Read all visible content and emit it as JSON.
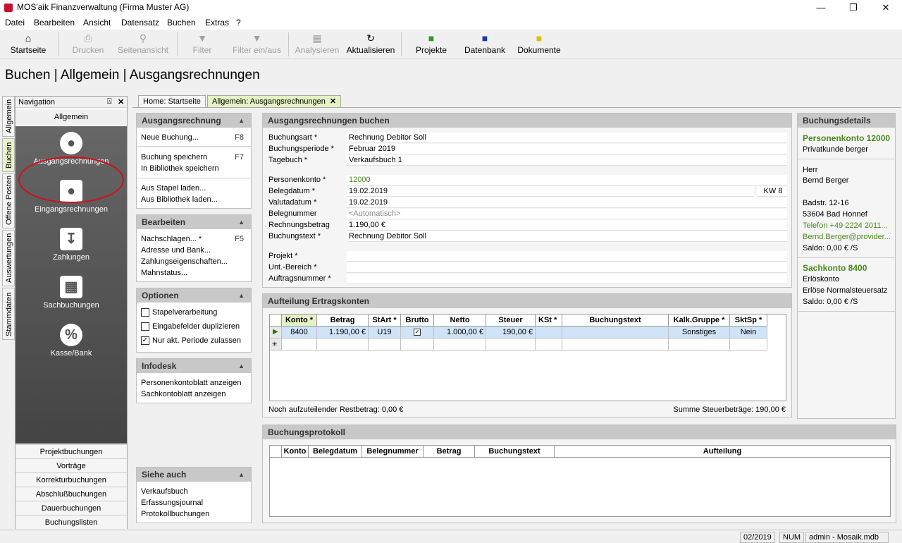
{
  "window": {
    "title": "MOS'aik Finanzverwaltung (Firma Muster AG)",
    "minimize": "—",
    "maximize": "❐",
    "close": "✕"
  },
  "menu": [
    "Datei",
    "Bearbeiten",
    "Ansicht",
    "Datensatz",
    "Buchen",
    "Extras",
    "?"
  ],
  "toolbar": {
    "startseite": "Startseite",
    "drucken": "Drucken",
    "seitenansicht": "Seitenansicht",
    "filter": "Filter",
    "filter_einaus": "Filter ein/aus",
    "analysieren": "Analysieren",
    "aktualisieren": "Aktualisieren",
    "projekte": "Projekte",
    "datenbank": "Datenbank",
    "dokumente": "Dokumente"
  },
  "page_title": "Buchen | Allgemein | Ausgangsrechnungen",
  "side_tabs": [
    "Allgemein",
    "Buchen",
    "Offene Posten",
    "Auswertungen",
    "Stammdaten"
  ],
  "navigation": {
    "title": "Navigation",
    "pin": "⍓",
    "close": "✕",
    "group": "Allgemein",
    "big_items": [
      "Ausgangsrechnungen",
      "Eingangsrechnungen",
      "Zahlungen",
      "Sachbuchungen",
      "Kasse/Bank"
    ],
    "list_items": [
      "Projektbuchungen",
      "Vorträge",
      "Korrekturbuchungen",
      "Abschlußbuchungen",
      "Dauerbuchungen",
      "Buchungslisten"
    ]
  },
  "doc_tabs": {
    "home": "Home: Startseite",
    "current": "Allgemein: Ausgangsrechnungen"
  },
  "tasks": {
    "ausgangsrechnung": {
      "title": "Ausgangsrechnung",
      "neue": "Neue Buchung...",
      "neue_key": "F8",
      "speichern": "Buchung speichern",
      "speichern_key": "F7",
      "bibliothek_speichern": "In Bibliothek speichern",
      "stapel": "Aus Stapel laden...",
      "bibliothek_laden": "Aus Bibliothek laden..."
    },
    "bearbeiten": {
      "title": "Bearbeiten",
      "nachschlagen": "Nachschlagen... *",
      "nachschlagen_key": "F5",
      "adresse": "Adresse und Bank...",
      "zahlung": "Zahlungseigenschaften...",
      "mahn": "Mahnstatus..."
    },
    "optionen": {
      "title": "Optionen",
      "stapel": "Stapelverarbeitung",
      "stapel_checked": false,
      "duplizieren": "Eingabefelder duplizieren",
      "duplizieren_checked": false,
      "periode": "Nur akt. Periode zulassen",
      "periode_checked": true
    },
    "infodesk": {
      "title": "Infodesk",
      "personen": "Personenkontoblatt anzeigen",
      "sach": "Sachkontoblatt anzeigen"
    },
    "siehe": {
      "title": "Siehe auch",
      "verkauf": "Verkaufsbuch",
      "erfassung": "Erfassungsjournal",
      "protokoll": "Protokollbuchungen"
    }
  },
  "form": {
    "title": "Ausgangsrechnungen buchen",
    "fields": {
      "buchungsart": {
        "label": "Buchungsart *",
        "value": "Rechnung Debitor Soll"
      },
      "buchungsperiode": {
        "label": "Buchungsperiode *",
        "value": "Februar 2019"
      },
      "tagebuch": {
        "label": "Tagebuch *",
        "value": "Verkaufsbuch 1"
      },
      "personenkonto": {
        "label": "Personenkonto *",
        "value": "12000"
      },
      "belegdatum": {
        "label": "Belegdatum *",
        "value": "19.02.2019",
        "kw": "KW 8"
      },
      "valutadatum": {
        "label": "Valutadatum *",
        "value": "19.02.2019"
      },
      "belegnummer": {
        "label": "Belegnummer",
        "value": "<Automatisch>"
      },
      "rechnungsbetrag": {
        "label": "Rechnungsbetrag",
        "value": "1.190,00 €"
      },
      "buchungstext": {
        "label": "Buchungstext *",
        "value": "Rechnung Debitor Soll"
      },
      "projekt": {
        "label": "Projekt *",
        "value": ""
      },
      "bereich": {
        "label": "Unt.-Bereich *",
        "value": ""
      },
      "auftrag": {
        "label": "Auftragsnummer *",
        "value": ""
      }
    }
  },
  "aufteilung": {
    "title": "Aufteilung Ertragskonten",
    "columns": [
      "Konto *",
      "Betrag",
      "StArt *",
      "Brutto",
      "Netto",
      "Steuer",
      "KSt *",
      "Buchungstext",
      "Kalk.Gruppe *",
      "SktSp *"
    ],
    "row": {
      "konto": "8400",
      "betrag": "1.190,00 €",
      "start": "U19",
      "brutto": true,
      "netto": "1.000,00 €",
      "steuer": "190,00 €",
      "kst": "",
      "text": "",
      "kalk": "Sonstiges",
      "sktsp": "Nein"
    },
    "new_row_marker": "✳",
    "restbetrag": "Noch aufzuteilender Restbetrag: 0,00 €",
    "steuersumme": "Summe Steuerbeträge: 190,00 €"
  },
  "protokoll": {
    "title": "Buchungsprotokoll",
    "columns": [
      "Konto",
      "Belegdatum",
      "Belegnummer",
      "Betrag",
      "Buchungstext",
      "Aufteilung"
    ]
  },
  "details": {
    "title": "Buchungsdetails",
    "personen_title": "Personenkonto 12000",
    "personen_sub": "Privatkunde berger",
    "anrede": "Herr",
    "name": "Bernd Berger",
    "strasse": "Badstr. 12-16",
    "ort": "53604 Bad Honnef",
    "telefon": "Telefon +49 2224 2011...",
    "email": "Bernd.Berger@provider...",
    "saldo1": "Saldo: 0,00 € /S",
    "sach_title": "Sachkonto 8400",
    "sach_sub": "Erlöskonto",
    "sach_text": "Erlöse Normalsteuersatz",
    "saldo2": "Saldo: 0,00 € /S"
  },
  "status": {
    "periode": "02/2019",
    "num": "NUM",
    "user": "admin - Mosaik.mdb"
  },
  "colors": {
    "accent_green": "#4a8a1c",
    "selected_row": "#cfe4f8",
    "active_tab": "#e4f2c4",
    "highlight_red": "#d0101a"
  }
}
